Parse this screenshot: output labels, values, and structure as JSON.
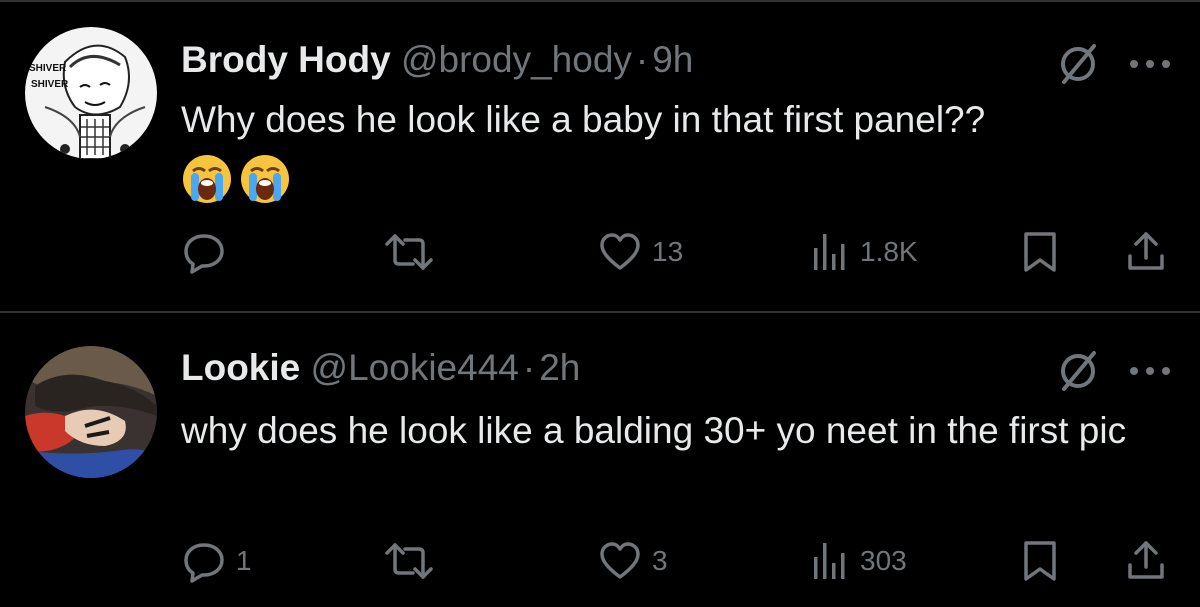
{
  "tweets": [
    {
      "name": "Brody Hody",
      "handle": "@brody_hody",
      "separator": "·",
      "time": "9h",
      "text": "Why does he look like a baby in that first panel??",
      "emojis": [
        "loudly-crying-face",
        "loudly-crying-face"
      ],
      "avatar_text": [
        "SHIVER",
        "SHIVER"
      ],
      "stats": {
        "replies": "",
        "retweets": "",
        "likes": "13",
        "views": "1.8K"
      }
    },
    {
      "name": "Lookie",
      "handle": "@Lookie444",
      "separator": "·",
      "time": "2h",
      "text": "why does he look like a balding 30+ yo neet in the first pic",
      "emojis": [],
      "stats": {
        "replies": "1",
        "retweets": "",
        "likes": "3",
        "views": "303"
      }
    }
  ],
  "icons": [
    "reply-icon",
    "retweet-icon",
    "like-icon",
    "views-icon",
    "bookmark-icon",
    "share-icon",
    "grok-icon",
    "more-icon"
  ],
  "colors": {
    "background": "#000000",
    "text": "#e7e9ea",
    "muted": "#71767b",
    "divider": "#2f3336"
  }
}
